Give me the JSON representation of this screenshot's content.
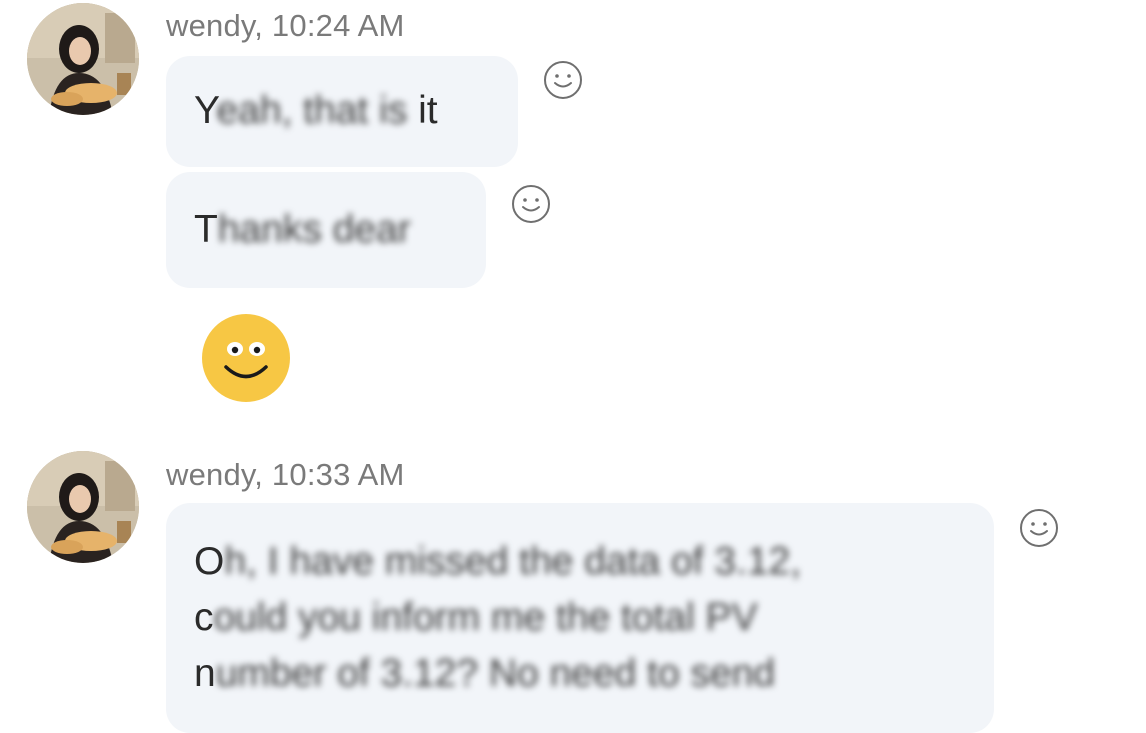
{
  "messages": [
    {
      "sender": "wendy, 10:24 AM",
      "bubbles": [
        {
          "first_char": "Y",
          "hidden": "eah, that is",
          "last_part": " it"
        },
        {
          "first_char": "T",
          "hidden": "hanks dear"
        }
      ],
      "emoji": "smiley-face"
    },
    {
      "sender": "wendy, 10:33 AM",
      "bubbles": [
        {
          "lines": [
            {
              "first_char": "O",
              "hidden": "h, I have missed the data of 3.12,"
            },
            {
              "first_char": "c",
              "hidden": "ould you inform me the total PV"
            },
            {
              "first_char": "n",
              "hidden": "umber of 3.12? No need to send"
            }
          ]
        }
      ]
    }
  ],
  "icons": {
    "reaction": "add-reaction-smiley-icon",
    "emoji": "yellow-smiley-emoji"
  },
  "colors": {
    "bubble_bg": "#f2f5f9",
    "sender_text": "#7a7a7a",
    "emoji_yellow": "#f7c744"
  }
}
